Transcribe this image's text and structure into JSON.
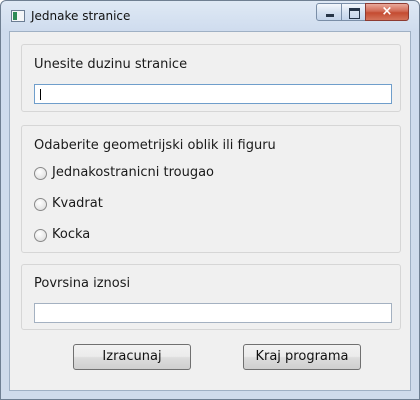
{
  "window": {
    "title": "Jednake stranice",
    "close_glyph": "×"
  },
  "side_input": {
    "label": "Unesite duzinu stranice",
    "value": ""
  },
  "shape_group": {
    "label": "Odaberite geometrijski oblik ili figuru",
    "options": [
      {
        "label": "Jednakostranicni trougao",
        "selected": false
      },
      {
        "label": "Kvadrat",
        "selected": false
      },
      {
        "label": "Kocka",
        "selected": false
      }
    ]
  },
  "result": {
    "label": "Povrsina iznosi",
    "value": ""
  },
  "buttons": {
    "calculate": "Izracunaj",
    "exit": "Kraj programa"
  }
}
